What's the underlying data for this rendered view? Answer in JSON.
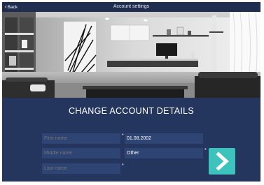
{
  "navbar": {
    "back_label": "Back",
    "title": "Account settings"
  },
  "panel": {
    "heading": "CHANGE ACCOUNT DETAILS",
    "left_fields": [
      {
        "placeholder": "First name",
        "required_mark": "*"
      },
      {
        "placeholder": "Middle name",
        "required_mark": ""
      },
      {
        "placeholder": "Last name",
        "required_mark": "*"
      }
    ],
    "right_fields": [
      {
        "value": "01.08.2002",
        "required_mark": "*"
      },
      {
        "value": "Other",
        "required_mark": "*"
      }
    ],
    "next_button": {
      "icon": "chevron-right-icon"
    }
  },
  "colors": {
    "panel_bg": "#24355e",
    "field_bg": "#2e4473",
    "accent": "#3cc3bd"
  }
}
